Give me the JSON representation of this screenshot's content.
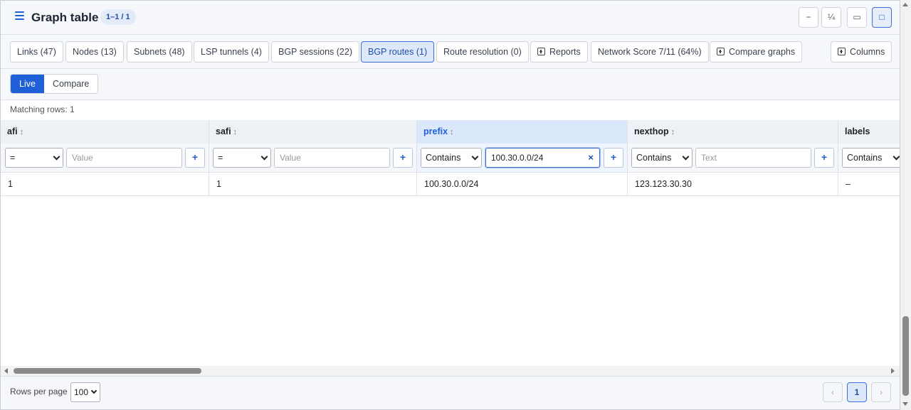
{
  "header": {
    "title": "Graph table",
    "count_badge": "1–1 / 1",
    "window_buttons": {
      "minimize": "−",
      "quarter": "¼",
      "half": "▭",
      "full": "□"
    }
  },
  "tabs": [
    {
      "label": "Links (47)"
    },
    {
      "label": "Nodes (13)"
    },
    {
      "label": "Subnets (48)"
    },
    {
      "label": "LSP tunnels (4)"
    },
    {
      "label": "BGP sessions (22)"
    },
    {
      "label": "BGP routes (1)",
      "active": true
    },
    {
      "label": "Route resolution (0)"
    },
    {
      "label": "Reports"
    },
    {
      "label": "Network Score 7/11 (64%)"
    },
    {
      "label": "Compare graphs"
    }
  ],
  "columns_button": "Columns",
  "mode": {
    "live": "Live",
    "compare": "Compare",
    "selected": "Live"
  },
  "matching_rows": "Matching rows: 1",
  "table": {
    "sort_glyph": "↕",
    "columns": [
      {
        "header": "afi",
        "op": "=",
        "placeholder": "Value",
        "value": ""
      },
      {
        "header": "safi",
        "op": "=",
        "placeholder": "Value",
        "value": ""
      },
      {
        "header": "prefix",
        "op": "Contains",
        "placeholder": "",
        "value": "100.30.0.0/24",
        "highlighted": true
      },
      {
        "header": "nexthop",
        "op": "Contains",
        "placeholder": "Text",
        "value": ""
      },
      {
        "header": "labels",
        "op": "Contains",
        "placeholder": "",
        "value": ""
      }
    ],
    "add_button": "+",
    "clear_icon": "×",
    "rows": [
      [
        "1",
        "1",
        "100.30.0.0/24",
        "123.123.30.30",
        "–"
      ]
    ]
  },
  "footer": {
    "rows_per_page_label": "Rows per page",
    "rows_per_page_value": "100",
    "prev": "‹",
    "page": "1",
    "next": "›"
  },
  "colors": {
    "accent": "#1f5fd8",
    "highlight_col": "#dbe7fb"
  }
}
